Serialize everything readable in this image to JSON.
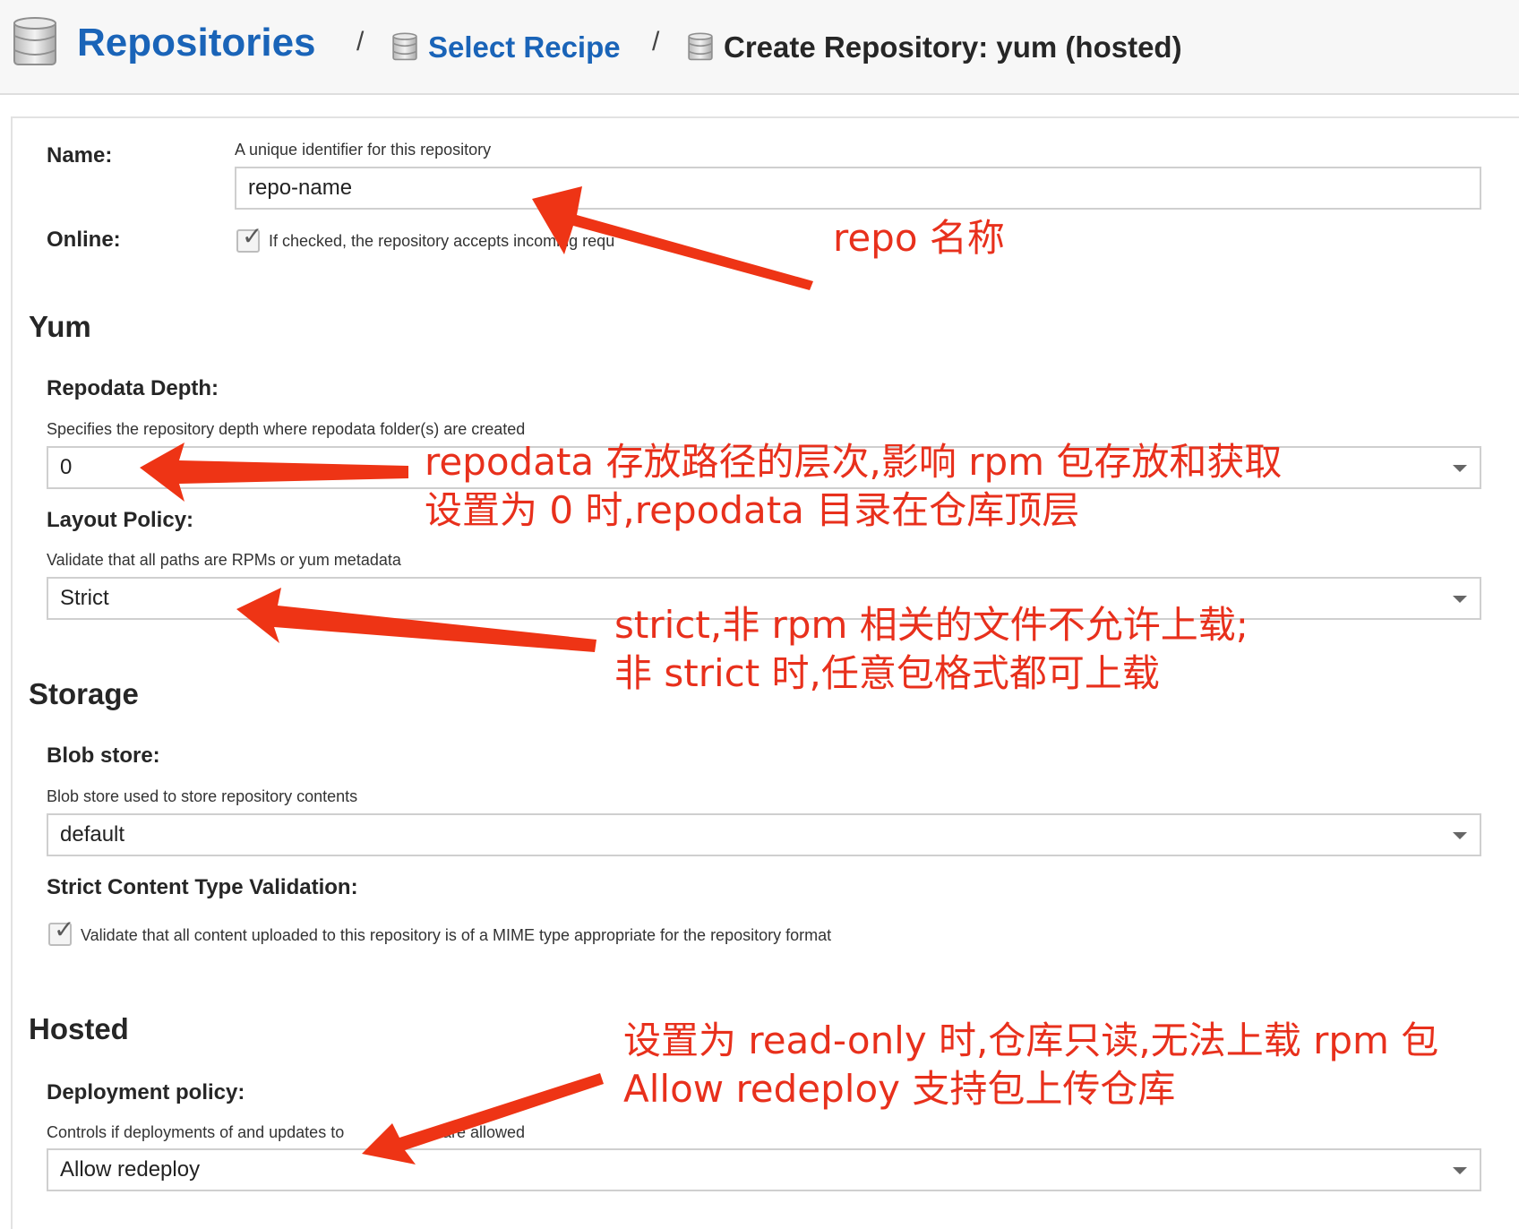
{
  "breadcrumb": {
    "root": "Repositories",
    "separator": "/",
    "middle": "Select Recipe",
    "current": "Create Repository: yum (hosted)"
  },
  "form": {
    "name": {
      "label": "Name:",
      "help": "A unique identifier for this repository",
      "value": "repo-name"
    },
    "online": {
      "label": "Online:",
      "help": "If checked, the repository accepts incoming requ",
      "checked": true
    }
  },
  "yum": {
    "section_title": "Yum",
    "repodata_depth": {
      "label": "Repodata Depth:",
      "help": "Specifies the repository depth where repodata folder(s) are created",
      "value": "0"
    },
    "layout_policy": {
      "label": "Layout Policy:",
      "help": "Validate that all paths are RPMs or yum metadata",
      "value": "Strict"
    }
  },
  "storage": {
    "section_title": "Storage",
    "blob_store": {
      "label": "Blob store:",
      "help": "Blob store used to store repository contents",
      "value": "default"
    },
    "strict_content": {
      "label": "Strict Content Type Validation:",
      "help": "Validate that all content uploaded to this repository is of a MIME type appropriate for the repository format",
      "checked": true
    }
  },
  "hosted": {
    "section_title": "Hosted",
    "deployment_policy": {
      "label": "Deployment policy:",
      "help_left": "Controls if deployments of and updates to",
      "help_right": "are allowed",
      "value": "Allow redeploy"
    }
  },
  "annotations": {
    "name": "repo 名称",
    "depth_line1": "repodata 存放路径的层次,影响 rpm 包存放和获取",
    "depth_line2": "设置为 0 时,repodata 目录在仓库顶层",
    "layout_line1": "strict,非 rpm 相关的文件不允许上载;",
    "layout_line2": "非 strict 时,任意包格式都可上载",
    "deploy_line1": "设置为 read-only 时,仓库只读,无法上载 rpm 包",
    "deploy_line2": "Allow redeploy 支持包上传仓库"
  },
  "colors": {
    "link": "#1a64b8",
    "annotation": "#e8301c"
  },
  "icons": [
    "database-icon",
    "checkmark-icon",
    "dropdown-caret-icon"
  ]
}
